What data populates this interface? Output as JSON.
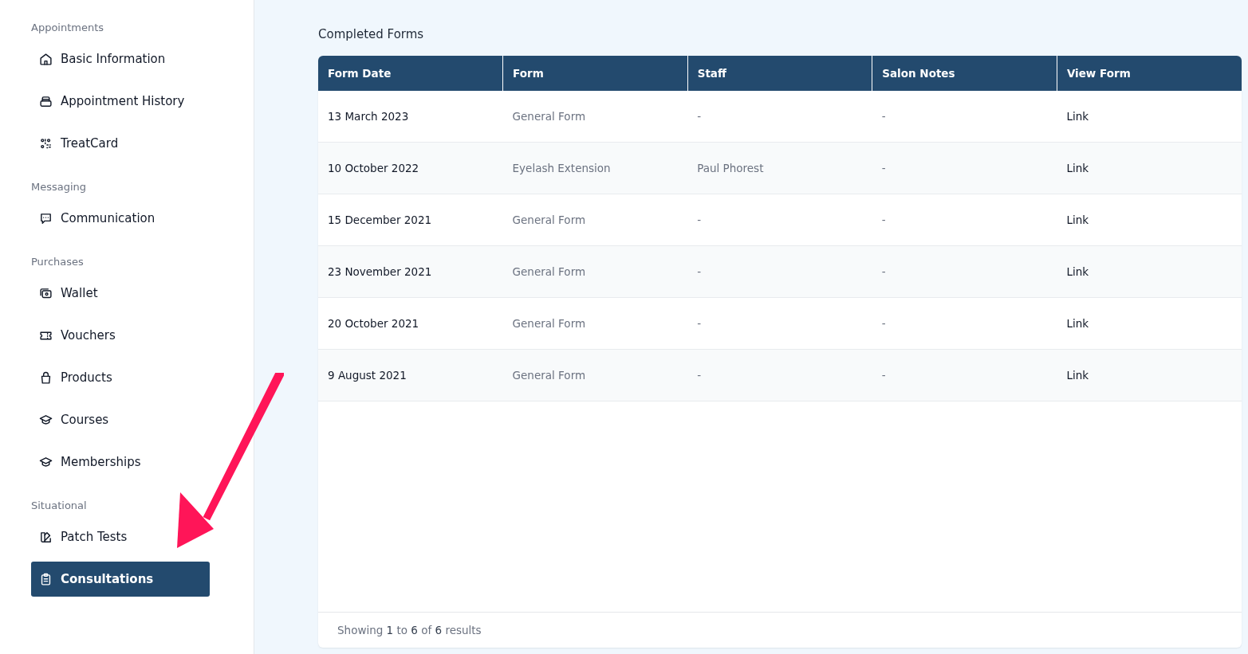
{
  "sidebar": {
    "sections": [
      {
        "label": "Appointments",
        "items": [
          {
            "label": "Basic Information",
            "selected": false
          },
          {
            "label": "Appointment History",
            "selected": false
          },
          {
            "label": "TreatCard",
            "selected": false
          }
        ]
      },
      {
        "label": "Messaging",
        "items": [
          {
            "label": "Communication",
            "selected": false
          }
        ]
      },
      {
        "label": "Purchases",
        "items": [
          {
            "label": "Wallet",
            "selected": false
          },
          {
            "label": "Vouchers",
            "selected": false
          },
          {
            "label": "Products",
            "selected": false
          },
          {
            "label": "Courses",
            "selected": false
          },
          {
            "label": "Memberships",
            "selected": false
          }
        ]
      },
      {
        "label": "Situational",
        "items": [
          {
            "label": "Patch Tests",
            "selected": false
          },
          {
            "label": "Consultations",
            "selected": true
          }
        ]
      }
    ]
  },
  "main": {
    "title": "Completed Forms",
    "table": {
      "columns": [
        "Form Date",
        "Form",
        "Staff",
        "Salon Notes",
        "View Form"
      ],
      "rows": [
        {
          "form_date": "13 March 2023",
          "form": "General Form",
          "staff": "-",
          "salon_notes": "-",
          "view_form": "Link"
        },
        {
          "form_date": "10 October 2022",
          "form": "Eyelash Extension",
          "staff": "Paul Phorest",
          "salon_notes": "-",
          "view_form": "Link"
        },
        {
          "form_date": "15 December 2021",
          "form": "General Form",
          "staff": "-",
          "salon_notes": "-",
          "view_form": "Link"
        },
        {
          "form_date": "23 November 2021",
          "form": "General Form",
          "staff": "-",
          "salon_notes": "-",
          "view_form": "Link"
        },
        {
          "form_date": "20 October 2021",
          "form": "General Form",
          "staff": "-",
          "salon_notes": "-",
          "view_form": "Link"
        },
        {
          "form_date": "9 August 2021",
          "form": "General Form",
          "staff": "-",
          "salon_notes": "-",
          "view_form": "Link"
        }
      ]
    },
    "footer": "Showing **1** to **6** of **6** results"
  }
}
